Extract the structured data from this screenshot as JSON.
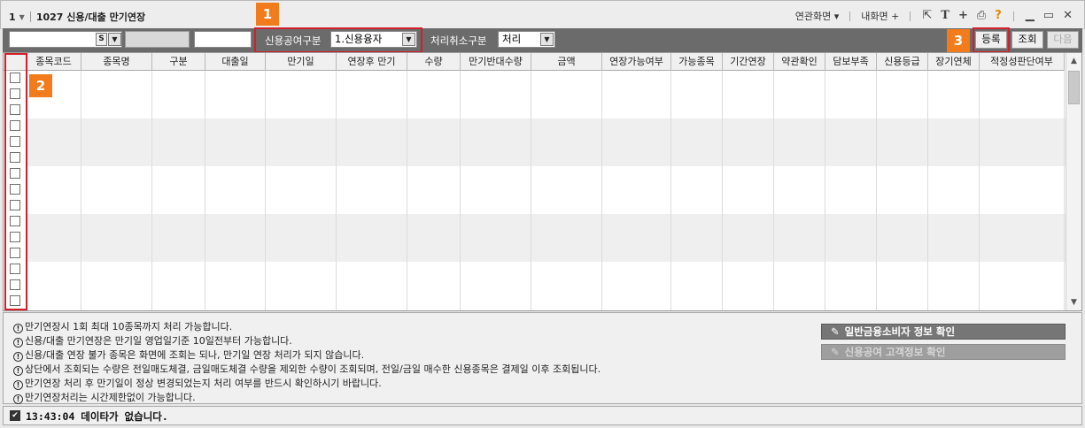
{
  "window": {
    "screen_no": "1",
    "title": "1027 신용/대출 만기연장",
    "links": {
      "related": "연관화면",
      "my": "내화면"
    }
  },
  "toolbar": {
    "code_prefix": "S",
    "credit_label": "신용공여구분",
    "credit_value": "1.신용융자",
    "cancel_label": "처리취소구분",
    "cancel_value": "처리",
    "register": "등록",
    "inquiry": "조회",
    "next": "다음"
  },
  "badges": [
    "1",
    "2",
    "3"
  ],
  "table": {
    "columns": [
      "종목코드",
      "종목명",
      "구분",
      "대출일",
      "만기일",
      "연장후 만기",
      "수량",
      "만기반대수량",
      "금액",
      "연장가능여부",
      "가능종목",
      "기간연장",
      "약관확인",
      "담보부족",
      "신용등급",
      "장기연체",
      "적정성판단여부"
    ],
    "rows": 15
  },
  "notes": [
    "만기연장시 1회 최대 10종목까지 처리 가능합니다.",
    "신용/대출 만기연장은 만기일 영업일기준 10일전부터 가능합니다.",
    "신용/대출 연장 불가 종목은 화면에 조회는 되나, 만기일 연장 처리가 되지 않습니다.",
    "상단에서 조회되는 수량은 전일매도체결, 금일매도체결 수량을 제외한 수량이 조회되며, 전일/금일 매수한 신용종목은 결제일 이후 조회됩니다.",
    "만기연장 처리 후 만기일이 정상 변경되었는지 처리 여부를 반드시 확인하시기 바랍니다.",
    "만기연장처리는 시간제한없이 가능합니다."
  ],
  "info_buttons": {
    "consumer": "일반금융소비자 정보 확인",
    "customer": "신용공여 고객정보 확인"
  },
  "status": {
    "text": "13:43:04  데이타가 없습니다."
  },
  "colors": {
    "highlight": "#d21f2b",
    "badge": "#f27b1c",
    "toolbar": "#6b6b6b"
  }
}
